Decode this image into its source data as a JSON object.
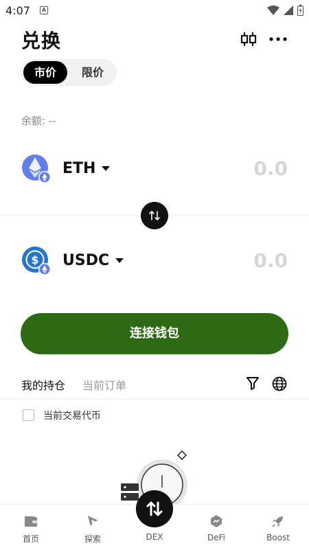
{
  "status_bar": {
    "time": "4:07",
    "a_icon": "A"
  },
  "header": {
    "title": "兑换"
  },
  "order_type": {
    "active": "市价",
    "inactive": "限价"
  },
  "balance": {
    "label": "余额: --"
  },
  "from_token": {
    "symbol": "ETH",
    "amount": "0.0",
    "color": "#627eea"
  },
  "to_token": {
    "symbol": "USDC",
    "amount": "0.0",
    "color": "#2775ca"
  },
  "connect_button": {
    "label": "连接钱包",
    "color": "#2d6a14"
  },
  "tabs": {
    "holdings": "我的持仓",
    "orders": "当前订单"
  },
  "filter": {
    "current_pair_label": "当前交易代币"
  },
  "bottom_nav": {
    "home": "首页",
    "explore": "探索",
    "dex": "DEX",
    "defi": "DeFi",
    "boost": "Boost"
  }
}
